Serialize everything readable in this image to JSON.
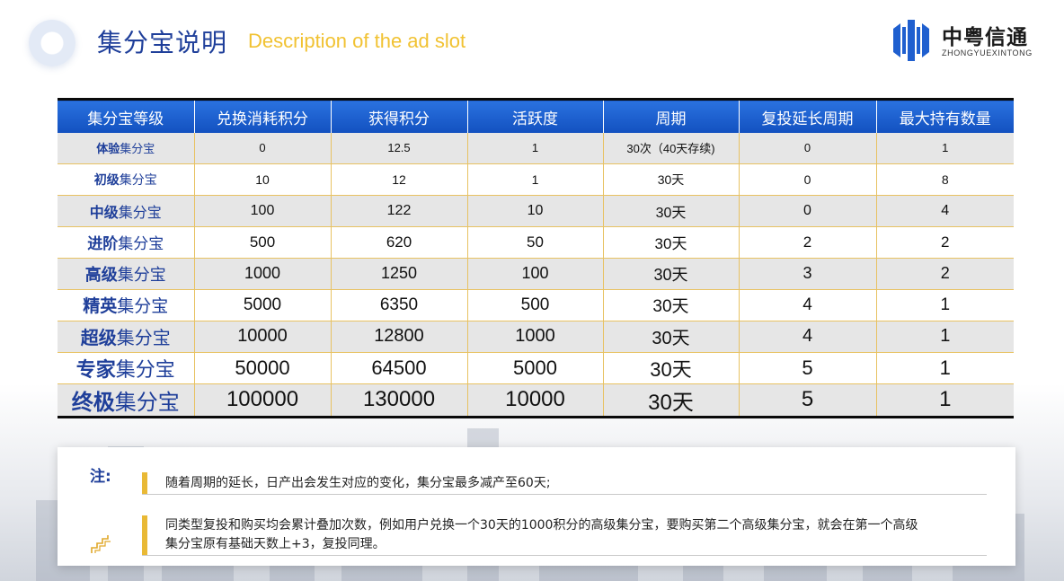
{
  "header": {
    "title_cn": "集分宝说明",
    "title_en": "Description of the ad slot"
  },
  "logo": {
    "name": "中粤信通",
    "sub": "ZHONGYUEXINTONG",
    "color": "#1f5fcf"
  },
  "table": {
    "headers": [
      "集分宝等级",
      "兑换消耗积分",
      "获得积分",
      "活跃度",
      "周期",
      "复投延长周期",
      "最大持有数量"
    ],
    "level_suffix": "集分宝",
    "rows": [
      {
        "level": "体验",
        "cost": "0",
        "points": "12.5",
        "activity": "1",
        "period": "30次（40天存续)",
        "extend": "0",
        "max": "1"
      },
      {
        "level": "初级",
        "cost": "10",
        "points": "12",
        "activity": "1",
        "period": "30天",
        "extend": "0",
        "max": "8"
      },
      {
        "level": "中级",
        "cost": "100",
        "points": "122",
        "activity": "10",
        "period": "30天",
        "extend": "0",
        "max": "4"
      },
      {
        "level": "进阶",
        "cost": "500",
        "points": "620",
        "activity": "50",
        "period": "30天",
        "extend": "2",
        "max": "2"
      },
      {
        "level": "高级",
        "cost": "1000",
        "points": "1250",
        "activity": "100",
        "period": "30天",
        "extend": "3",
        "max": "2"
      },
      {
        "level": "精英",
        "cost": "5000",
        "points": "6350",
        "activity": "500",
        "period": "30天",
        "extend": "4",
        "max": "1"
      },
      {
        "level": "超级",
        "cost": "10000",
        "points": "12800",
        "activity": "1000",
        "period": "30天",
        "extend": "4",
        "max": "1"
      },
      {
        "level": "专家",
        "cost": "50000",
        "points": "64500",
        "activity": "5000",
        "period": "30天",
        "extend": "5",
        "max": "1"
      },
      {
        "level": "终极",
        "cost": "100000",
        "points": "130000",
        "activity": "10000",
        "period": "30天",
        "extend": "5",
        "max": "1"
      }
    ]
  },
  "notes": {
    "label": "注:",
    "items": [
      "随着周期的延长，日产出会发生对应的变化，集分宝最多减产至60天;",
      "同类型复投和购买均会累计叠加次数，例如用户兑换一个30天的1000积分的高级集分宝，要购买第二个高级集分宝，就会在第一个高级集分宝原有基础天数上+3，复投同理。"
    ]
  },
  "colors": {
    "primary": "#1f3f9a",
    "accent": "#f1c232",
    "header_bg": "#1a5ccc",
    "border": "#e8c262"
  },
  "icons": [
    "logo-mark-icon",
    "stair-icon"
  ]
}
